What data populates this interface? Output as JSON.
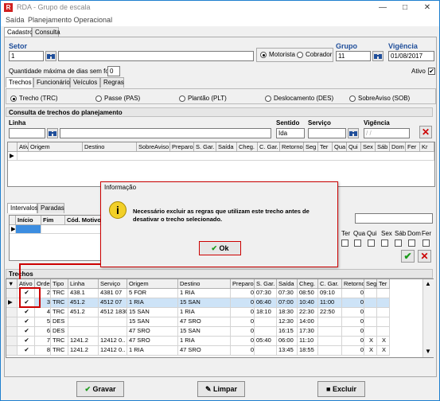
{
  "window": {
    "title": "RDA - Grupo de escala",
    "icon_letter": "R"
  },
  "menu": [
    "Saída",
    "Planejamento Operacional"
  ],
  "top_tabs": [
    "Cadastro",
    "Consulta"
  ],
  "setor": {
    "label": "Setor",
    "value": "1"
  },
  "tipo_options": [
    "Motorista",
    "Cobrador"
  ],
  "grupo": {
    "label": "Grupo",
    "value": "11"
  },
  "vigencia": {
    "label": "Vigência",
    "value": "01/08/2017"
  },
  "folga": {
    "label": "Quantidade máxima de dias sem folga",
    "value": "0"
  },
  "ativo_label": "Ativo",
  "sub_tabs": [
    "Trechos",
    "Funcionários",
    "Veículos",
    "Regras"
  ],
  "trecho_types": [
    "Trecho (TRC)",
    "Passe (PAS)",
    "Plantão (PLT)",
    "Deslocamento (DES)",
    "SobreAviso (SOB)"
  ],
  "consulta": {
    "title": "Consulta de trechos do planejamento",
    "linha_label": "Linha",
    "sentido_label": "Sentido",
    "sentido_value": "Ida",
    "servico_label": "Serviço",
    "vigencia_label": "Vigência",
    "vigencia_placeholder": "/ /",
    "columns": [
      "Ativo",
      "Origem",
      "Destino",
      "SobreAviso",
      "Preparo",
      "S. Gar.",
      "Saída",
      "Cheg.",
      "C. Gar.",
      "Retorno",
      "Seg",
      "Ter",
      "Qua",
      "Qui",
      "Sex",
      "Sáb",
      "Dom",
      "Fer",
      "Kr"
    ]
  },
  "intervalos": {
    "tabs": [
      "Intervalos",
      "Paradas"
    ],
    "columns": [
      "Início",
      "Fim",
      "Cód. Motivo"
    ],
    "days": [
      "Ter",
      "Qua",
      "Qui",
      "Sex",
      "Sáb",
      "Dom",
      "Fer"
    ]
  },
  "dialog": {
    "title": "Informação",
    "message_line1": "Necessário excluir as regras que utilizam este trecho antes de",
    "message_line2": "desativar o trecho selecionado.",
    "ok": "Ok"
  },
  "trechos": {
    "title": "Trechos",
    "columns": [
      "Ativo",
      "Ordem",
      "Tipo",
      "Linha",
      "Serviço",
      "Origem",
      "Destino",
      "Preparo",
      "S. Gar.",
      "Saída",
      "Cheg.",
      "C. Gar.",
      "Retorno",
      "Seg",
      "Ter"
    ],
    "rows": [
      {
        "ativo": "✔",
        "ordem": "2",
        "tipo": "TRC",
        "linha": "438.1",
        "servico": "4381 07",
        "origem": "5 FOR",
        "destino": "1 RIA",
        "preparo": "0",
        "sgar": "07:30",
        "saida": "07:30",
        "cheg": "08:50",
        "cgar": "09:10",
        "retorno": "0",
        "seg": "",
        "ter": ""
      },
      {
        "ativo": "✔",
        "ordem": "3",
        "tipo": "TRC",
        "linha": "451.2",
        "servico": "4512 07",
        "origem": "1 RIA",
        "destino": "15 SAN",
        "preparo": "0",
        "sgar": "06:40",
        "saida": "07:00",
        "cheg": "10:40",
        "cgar": "11:00",
        "retorno": "0",
        "seg": "",
        "ter": ""
      },
      {
        "ativo": "✔",
        "ordem": "4",
        "tipo": "TRC",
        "linha": "451.2",
        "servico": "4512 1830",
        "origem": "15 SAN",
        "destino": "1 RIA",
        "preparo": "0",
        "sgar": "18:10",
        "saida": "18:30",
        "cheg": "22:30",
        "cgar": "22:50",
        "retorno": "0",
        "seg": "",
        "ter": ""
      },
      {
        "ativo": "✔",
        "ordem": "5",
        "tipo": "DES",
        "linha": "",
        "servico": "",
        "origem": "15 SAN",
        "destino": "47 SRO",
        "preparo": "0",
        "sgar": "",
        "saida": "12:30",
        "cheg": "14:00",
        "cgar": "",
        "retorno": "0",
        "seg": "",
        "ter": ""
      },
      {
        "ativo": "✔",
        "ordem": "6",
        "tipo": "DES",
        "linha": "",
        "servico": "",
        "origem": "47 SRO",
        "destino": "15 SAN",
        "preparo": "0",
        "sgar": "",
        "saida": "16:15",
        "cheg": "17:30",
        "cgar": "",
        "retorno": "0",
        "seg": "",
        "ter": ""
      },
      {
        "ativo": "✔",
        "ordem": "7",
        "tipo": "TRC",
        "linha": "1241.2",
        "servico": "12412 0..",
        "origem": "47 SRO",
        "destino": "1 RIA",
        "preparo": "0",
        "sgar": "05:40",
        "saida": "06:00",
        "cheg": "11:10",
        "cgar": "",
        "retorno": "0",
        "seg": "X",
        "ter": "X"
      },
      {
        "ativo": "✔",
        "ordem": "8",
        "tipo": "TRC",
        "linha": "1241.2",
        "servico": "12412 0..",
        "origem": "1 RIA",
        "destino": "47 SRO",
        "preparo": "0",
        "sgar": "",
        "saida": "13:45",
        "cheg": "18:55",
        "cgar": "",
        "retorno": "0",
        "seg": "X",
        "ter": "X"
      }
    ]
  },
  "buttons": {
    "gravar": "Gravar",
    "limpar": "Limpar",
    "excluir": "Excluir"
  }
}
